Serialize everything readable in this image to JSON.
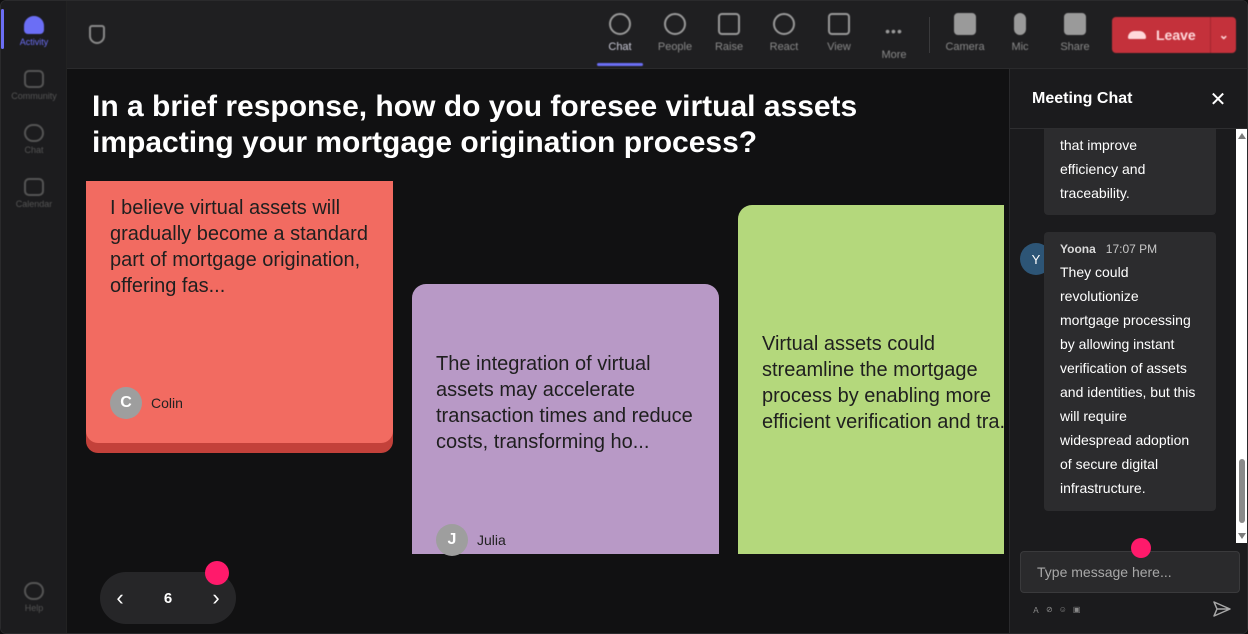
{
  "rail": {
    "items": [
      {
        "label": "Activity",
        "icon": "bell-icon",
        "active": true
      },
      {
        "label": "Community",
        "icon": "community-icon"
      },
      {
        "label": "Chat",
        "icon": "chat-bubble-icon"
      },
      {
        "label": "Calendar",
        "icon": "calendar-icon"
      }
    ],
    "help_label": "Help"
  },
  "toolbar": {
    "buttons": [
      {
        "label": "Chat",
        "icon": "chat-bubble-icon",
        "active": true
      },
      {
        "label": "People",
        "icon": "person-icon"
      },
      {
        "label": "Raise",
        "icon": "raise-hand-icon"
      },
      {
        "label": "React",
        "icon": "smiley-icon"
      },
      {
        "label": "View",
        "icon": "grid-icon"
      },
      {
        "label": "More",
        "icon": "more-dots-icon"
      },
      {
        "label": "Camera",
        "icon": "camera-off-icon"
      },
      {
        "label": "Mic",
        "icon": "microphone-icon"
      },
      {
        "label": "Share",
        "icon": "share-screen-icon"
      }
    ],
    "leave_label": "Leave"
  },
  "stage": {
    "question": "In a brief response, how do you foresee virtual assets impacting your mortgage origination process?",
    "cards": [
      {
        "text": "I believe virtual assets will gradually become a standard part of mortgage origination, offering fas...",
        "author": "Colin",
        "initial": "C",
        "color": "#f26b61"
      },
      {
        "text": "The integration of virtual assets may accelerate transaction times and reduce costs, transforming ho...",
        "author": "Julia",
        "initial": "J",
        "color": "#b899c6"
      },
      {
        "lines": [
          "Virtual assets could",
          "streamline the mortgage",
          "process by enabling more",
          "efficient verification and tra..."
        ],
        "color": "#b4d87c"
      }
    ],
    "pager": {
      "prev": "‹",
      "page": "6",
      "next": "›"
    }
  },
  "chat": {
    "title": "Meeting Chat",
    "close": "✕",
    "messages": [
      {
        "text_lines": [
          "that improve",
          "efficiency and",
          "traceability."
        ]
      },
      {
        "author": "Yoona",
        "initial": "Y",
        "time": "17:07 PM",
        "text": "They could revolutionize mortgage processing by allowing instant verification of assets and identities, but this will require widespread adoption of secure digital infrastructure."
      }
    ],
    "input_placeholder": "Type message here...",
    "format_icons": [
      "format-icon",
      "attach-icon",
      "emoji-icon",
      "gif-icon"
    ]
  },
  "colors": {
    "accent": "#6b6ef5",
    "leave": "#c4313b",
    "cursor": "#ff1a6b"
  }
}
